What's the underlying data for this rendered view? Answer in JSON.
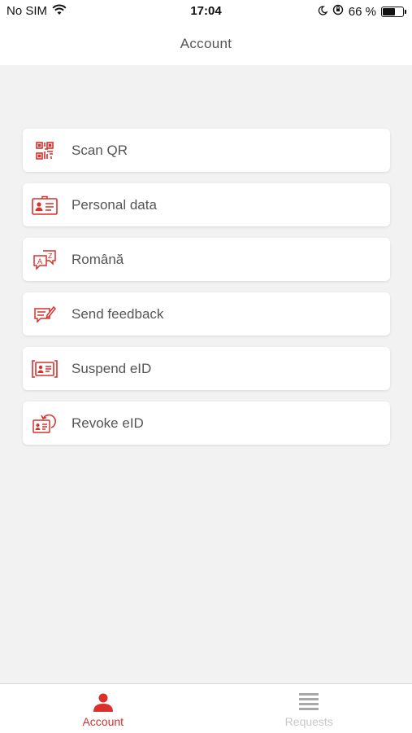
{
  "status_bar": {
    "carrier": "No SIM",
    "time": "17:04",
    "battery_text": "66 %",
    "battery_level": 0.66,
    "icons": [
      "wifi-icon",
      "moon-icon",
      "orientation-lock-icon",
      "battery-icon"
    ]
  },
  "header": {
    "title": "Account"
  },
  "menu": {
    "items": [
      {
        "label": "Scan QR",
        "icon": "qr-code-icon"
      },
      {
        "label": "Personal data",
        "icon": "id-card-icon"
      },
      {
        "label": "Română",
        "icon": "language-icon"
      },
      {
        "label": "Send feedback",
        "icon": "feedback-icon"
      },
      {
        "label": "Suspend eID",
        "icon": "suspend-id-icon"
      },
      {
        "label": "Revoke eID",
        "icon": "revoke-id-icon"
      }
    ]
  },
  "tabbar": {
    "tabs": [
      {
        "label": "Account",
        "icon": "person-icon",
        "active": true
      },
      {
        "label": "Requests",
        "icon": "list-icon",
        "active": false
      }
    ]
  },
  "colors": {
    "accent": "#d9302b",
    "background": "#f2f2f2",
    "inactive": "#c8c8c8"
  }
}
